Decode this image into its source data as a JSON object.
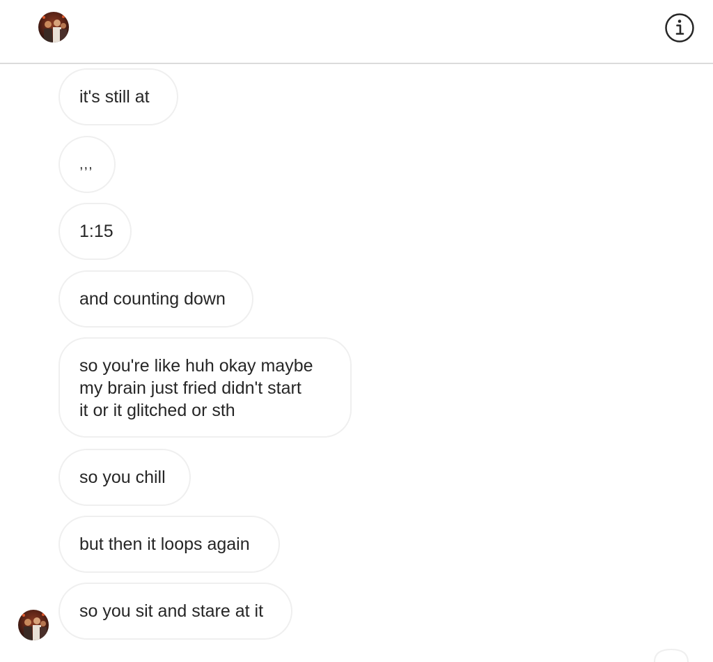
{
  "header": {
    "info_icon": "info-circle-icon",
    "avatar_icon": "profile-photo"
  },
  "messages": [
    {
      "text": "it's still at"
    },
    {
      "text": ",,,"
    },
    {
      "text": "1:15"
    },
    {
      "text": "and counting down"
    },
    {
      "lines": [
        "so you're like huh okay maybe",
        "my brain just fried didn't start",
        "it or it glitched or sth"
      ]
    },
    {
      "text": "so you chill"
    },
    {
      "text": "but then it loops again"
    },
    {
      "text": "so you sit and stare at it"
    }
  ],
  "colors": {
    "bubble_border": "#efefef",
    "text": "#262626",
    "divider": "#dbdbdb"
  }
}
